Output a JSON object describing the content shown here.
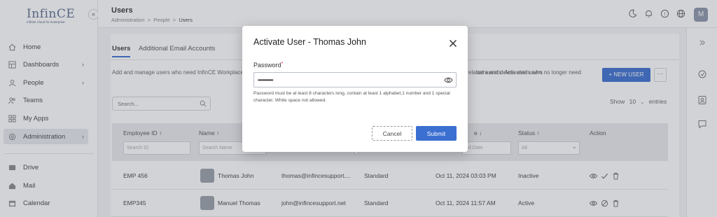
{
  "app": {
    "logo_text": "InfinCE",
    "logo_tagline": "Infinite Cloud for Enterprise"
  },
  "sidebar": {
    "items": [
      {
        "label": "Home",
        "icon": "home-icon"
      },
      {
        "label": "Dashboards",
        "icon": "dashboard-icon"
      },
      {
        "label": "People",
        "icon": "person-icon"
      },
      {
        "label": "Teams",
        "icon": "teams-icon"
      },
      {
        "label": "My Apps",
        "icon": "apps-icon"
      },
      {
        "label": "Administration",
        "icon": "admin-icon"
      },
      {
        "label": "Drive",
        "icon": "drive-icon"
      },
      {
        "label": "Mail",
        "icon": "mail-icon"
      },
      {
        "label": "Calendar",
        "icon": "calendar-icon"
      }
    ]
  },
  "header": {
    "title": "Users",
    "breadcrumb": [
      "Administration",
      "People",
      "Users"
    ],
    "breadcrumb_sep": ">",
    "avatar_initial": "M"
  },
  "main": {
    "tabs": [
      "Users",
      "Additional Email Accounts"
    ],
    "description": "Add and manage users who need InfinCE Workplace account, update user details and delete users who no longer need access to InfinCE and related assets. Activated users",
    "description_right": "sers and delete users who no longer need",
    "new_user_label": "+ NEW USER",
    "more_label": "···",
    "search_placeholder": "Search...",
    "show_label": "Show",
    "show_value": "10",
    "entries_label": "entries",
    "columns": [
      {
        "label": "Employee ID ↑",
        "filter": "Search ID"
      },
      {
        "label": "Name ↑",
        "filter": "Search Name"
      },
      {
        "label": "",
        "filter": ""
      },
      {
        "label": "",
        "filter": ""
      },
      {
        "label": "e ↓",
        "filter": "ed Date"
      },
      {
        "label": "Status ↑",
        "filter": "All"
      },
      {
        "label": "Action",
        "filter": ""
      }
    ],
    "rows": [
      {
        "id": "EMP 456",
        "name": "Thomas John",
        "email": "thomas@infincesupport....",
        "role": "Standard",
        "date": "Oct 11, 2024 03:03 PM",
        "status": "Inactive"
      },
      {
        "id": "EMP345",
        "name": "Manuel Thomas",
        "email": "john@infincesupport.net",
        "role": "Standard",
        "date": "Oct 11, 2024 11:57 AM",
        "status": "Active"
      }
    ]
  },
  "modal": {
    "title": "Activate User - Thomas John",
    "password_label": "Password",
    "required_mark": "*",
    "password_value": "••••••••••••",
    "hint": "Password must be at least 8 characters long, contain at least 1 alphabet,1 number and 1 special character. White space not allowed.",
    "cancel_label": "Cancel",
    "submit_label": "Submit"
  },
  "colors": {
    "primary": "#3b6fd1",
    "overlay": "rgba(75,80,90,0.25)"
  }
}
